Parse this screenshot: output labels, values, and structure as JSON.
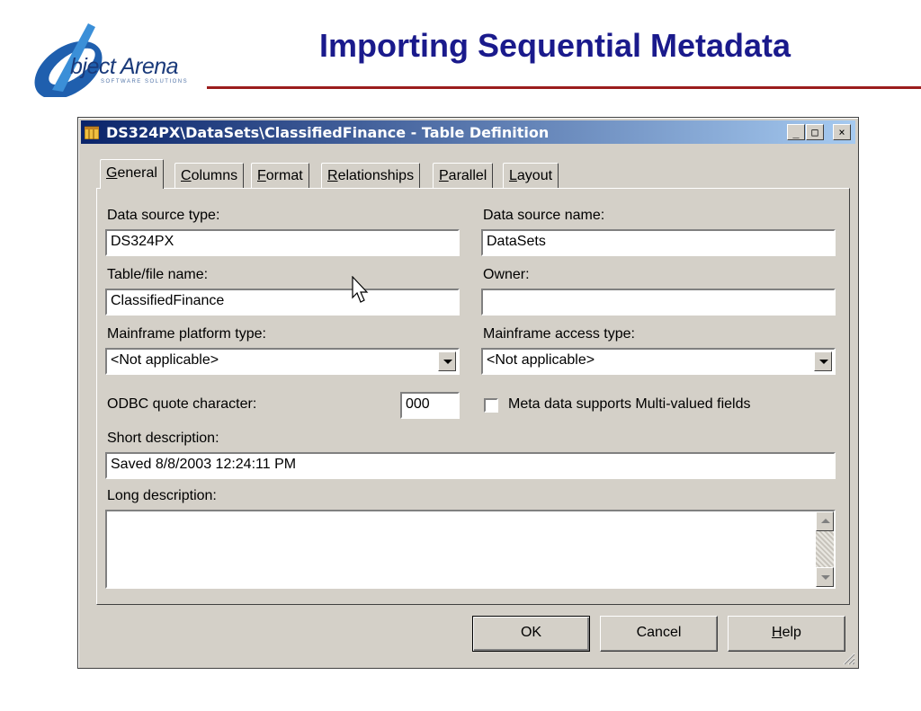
{
  "slide": {
    "title": "Importing Sequential Metadata",
    "logo_text": "bject Arena",
    "logo_subtext": "SOFTWARE SOLUTIONS"
  },
  "dialog": {
    "title": "DS324PX\\DataSets\\ClassifiedFinance - Table Definition",
    "window_buttons": {
      "minimize": "_",
      "maximize": "□",
      "close": "×"
    },
    "tabs": [
      {
        "key": "G",
        "rest": "eneral",
        "active": true
      },
      {
        "key": "C",
        "rest": "olumns"
      },
      {
        "key": "F",
        "rest": "ormat"
      },
      {
        "key": "R",
        "rest": "elationships"
      },
      {
        "key": "P",
        "rest": "arallel"
      },
      {
        "key": "L",
        "rest": "ayout"
      }
    ],
    "fields": {
      "data_source_type": {
        "label": "Data source type:",
        "value": "DS324PX"
      },
      "data_source_name": {
        "label": "Data source name:",
        "value": "DataSets"
      },
      "table_file_name": {
        "label": "Table/file name:",
        "value": "ClassifiedFinance"
      },
      "owner": {
        "label": "Owner:",
        "value": ""
      },
      "mainframe_platform_type": {
        "label": "Mainframe platform type:",
        "value": "<Not applicable>"
      },
      "mainframe_access_type": {
        "label": "Mainframe access type:",
        "value": "<Not applicable>"
      },
      "odbc_quote_character": {
        "label": "ODBC quote character:",
        "value": "000"
      },
      "multi_valued": {
        "label": "Meta data supports Multi-valued fields",
        "checked": false
      },
      "short_description": {
        "label": "Short description:",
        "value": "Saved 8/8/2003 12:24:11 PM"
      },
      "long_description": {
        "label": "Long description:",
        "value": ""
      }
    },
    "buttons": {
      "ok": "OK",
      "cancel": "Cancel",
      "help_key": "H",
      "help_rest": "elp"
    }
  },
  "colors": {
    "title_blue": "#1a1a8c",
    "rule_red": "#9b1c1c",
    "titlebar_start": "#0a246a",
    "titlebar_end": "#a6caf0",
    "dialog_face": "#d4d0c8"
  }
}
